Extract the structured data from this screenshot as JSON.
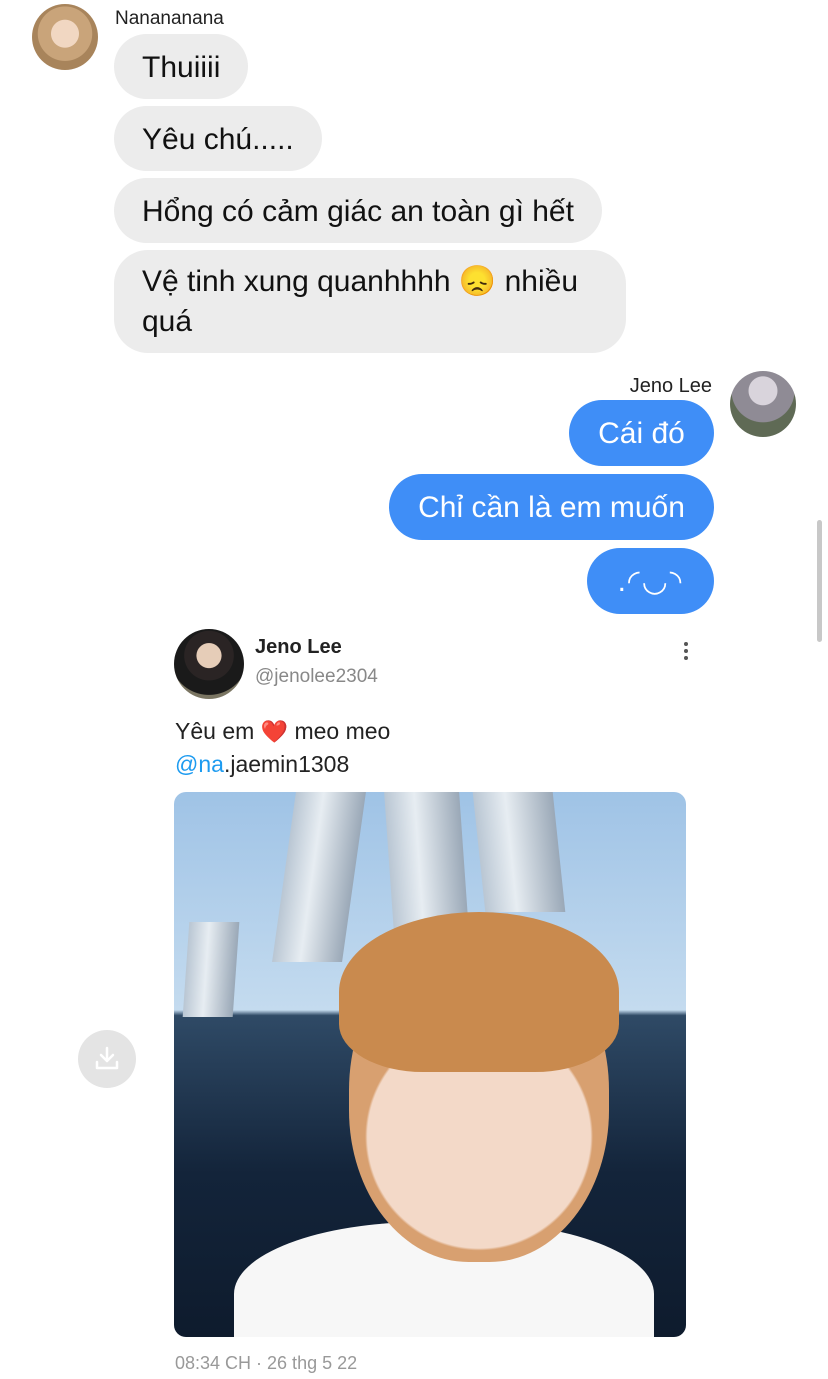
{
  "incoming": {
    "sender": "Nanananana",
    "messages": [
      "Thuiiii",
      "Yêu chú.....",
      "Hổng có cảm giác an toàn gì hết",
      "Vệ tinh xung quanhhhh 😞 nhiều quá"
    ]
  },
  "outgoing": {
    "sender": "Jeno Lee",
    "messages": [
      "Cái đó",
      "Chỉ cần là em muốn",
      ".◜◡◝"
    ]
  },
  "tweet": {
    "name": "Jeno Lee",
    "handle": "@jenolee2304",
    "text_prefix": "Yêu em",
    "heart": "❤️",
    "text_suffix": "meo meo",
    "mention_at": "@na",
    "mention_rest": ".jaemin1308",
    "timestamp": "08:34 CH · 26 thg 5 22"
  },
  "icons": {
    "more": "more-vertical-icon",
    "download": "download-icon"
  },
  "colors": {
    "outgoing_bubble": "#3f8ef7",
    "incoming_bubble": "#ececec",
    "mention": "#1d9bf0"
  }
}
